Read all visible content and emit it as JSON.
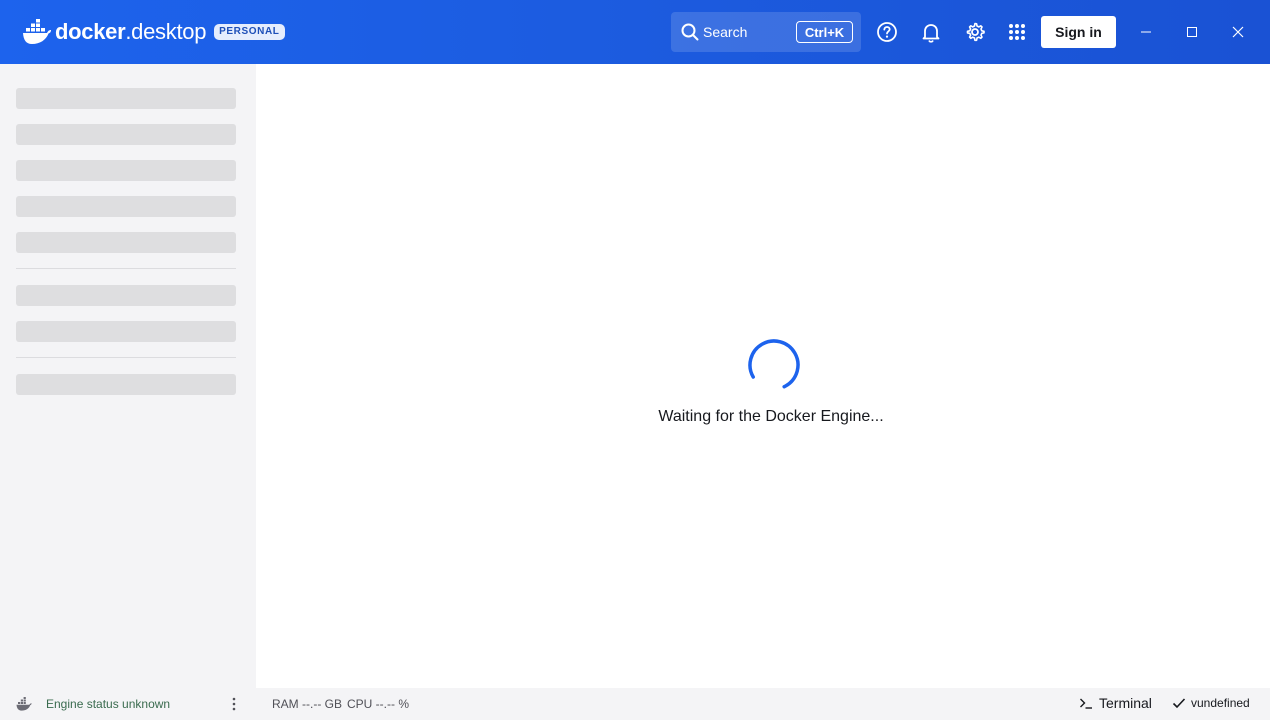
{
  "header": {
    "brand_bold": "docker",
    "brand_regular": ".desktop",
    "plan_badge": "PERSONAL",
    "search_label": "Search",
    "search_shortcut": "Ctrl+K",
    "sign_in_label": "Sign in",
    "icons": [
      "help-icon",
      "bell-icon",
      "gear-icon",
      "apps-grid-icon"
    ],
    "window_controls": [
      "minimize",
      "maximize",
      "close"
    ]
  },
  "sidebar": {
    "loading_placeholders": 8
  },
  "main": {
    "loading_message": "Waiting for the Docker Engine..."
  },
  "footer": {
    "engine_status": "Engine status unknown",
    "ram": "RAM --.-- GB",
    "cpu": "CPU --.-- %",
    "terminal_label": "Terminal",
    "version": "vundefined"
  },
  "colors": {
    "header": "#1d63ed",
    "spinner": "#1d63ed",
    "sidebar_bg": "#f4f4f6",
    "skeleton": "#dedee0"
  }
}
